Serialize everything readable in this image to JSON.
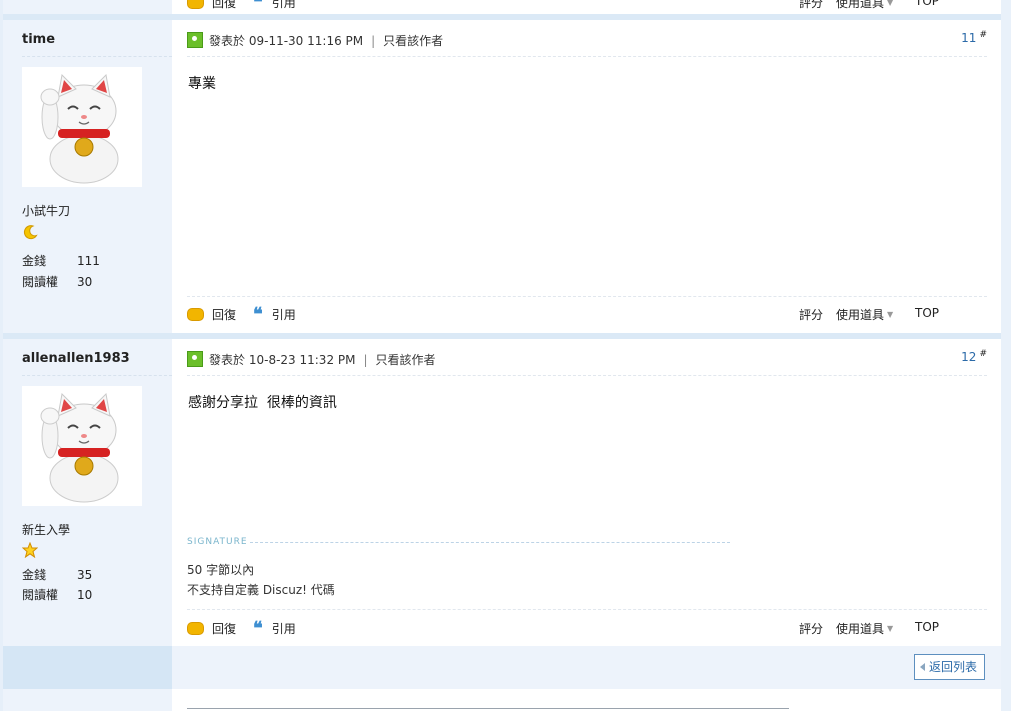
{
  "actions": {
    "reply": "回復",
    "quote": "引用",
    "rate": "評分",
    "tools": "使用道具",
    "top": "TOP"
  },
  "posts": [
    {
      "author": "time",
      "rank": "小試牛刀",
      "rank_icon": "moon-icon",
      "stats": [
        {
          "label": "金錢",
          "value": "111"
        },
        {
          "label": "閱讀權",
          "value": "30"
        }
      ],
      "posted_label": "發表於",
      "posted_time": "09-11-30 11:16 PM",
      "only_author": "只看該作者",
      "floor": "11",
      "floor_mark": "#",
      "content": "專業"
    },
    {
      "author": "allenallen1983",
      "rank": "新生入學",
      "rank_icon": "star-icon",
      "stats": [
        {
          "label": "金錢",
          "value": "35"
        },
        {
          "label": "閱讀權",
          "value": "10"
        }
      ],
      "posted_label": "發表於",
      "posted_time": "10-8-23 11:32 PM",
      "only_author": "只看該作者",
      "floor": "12",
      "floor_mark": "#",
      "content": "感謝分享拉  很棒的資訊",
      "signature_label": "SIGNATURE",
      "signature_lines": [
        "50 字節以內",
        "不支持自定義 Discuz! 代碼"
      ]
    }
  ],
  "footer": {
    "back_to_list": "返回列表"
  },
  "colors": {
    "accent": "#2b6aa8",
    "sidebar_bg": "#edf3fb",
    "page_bg": "#d9e8f5"
  }
}
